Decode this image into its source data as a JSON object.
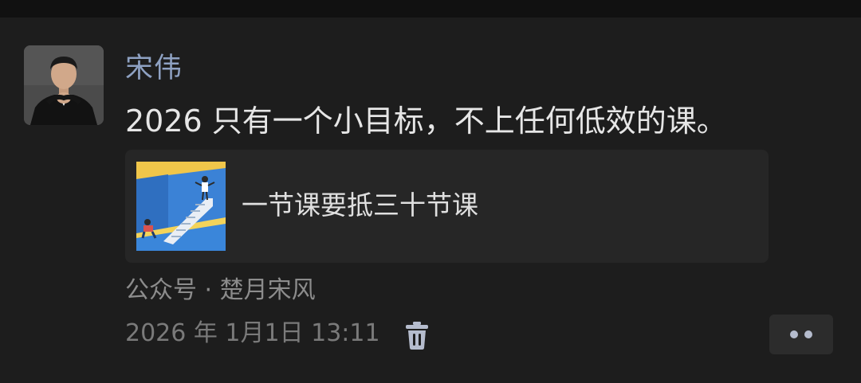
{
  "post": {
    "author": "宋伟",
    "content": "2026 只有一个小目标，不上任何低效的课。",
    "link_card": {
      "title": "一节课要抵三十节课"
    },
    "source": "公众号 · 楚月宋风",
    "timestamp": "2026 年 1月1日 13:11"
  },
  "icons": {
    "delete": "trash-icon",
    "more": "ellipsis-icon"
  },
  "colors": {
    "background": "#1d1d1d",
    "author_name": "#8ea1c2",
    "content_text": "#e6e6e6",
    "meta_text": "#8c8c8c",
    "card_background": "#262626"
  }
}
